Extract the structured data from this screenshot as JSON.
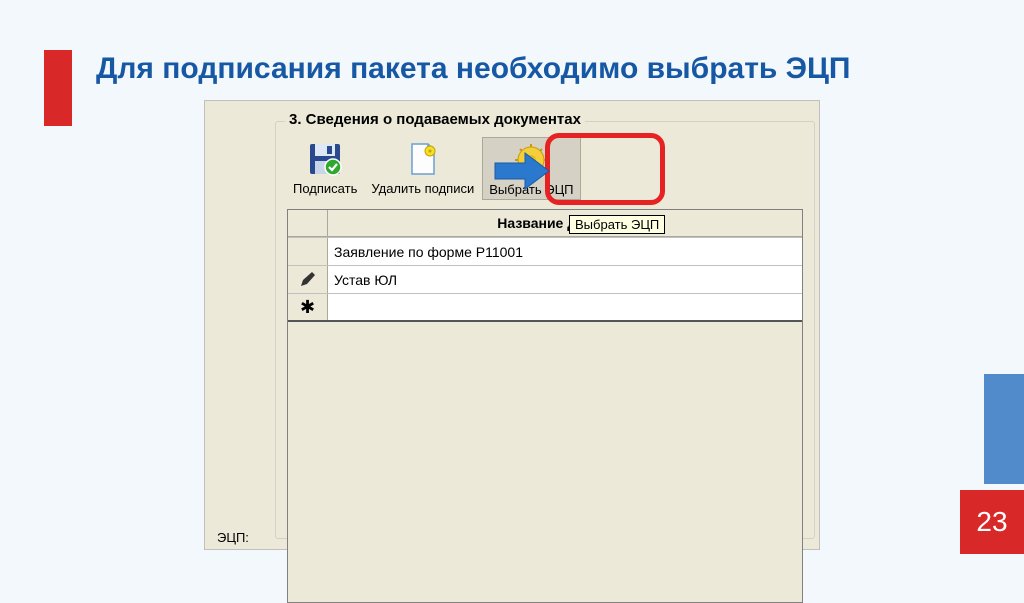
{
  "slide": {
    "title": "Для подписания пакета необходимо выбрать ЭЦП",
    "page_number": "23"
  },
  "panel": {
    "legend": "3. Сведения о подаваемых документах",
    "bottom_label": "ЭЦП:"
  },
  "toolbar": {
    "sign_label": "Подписать",
    "delete_sig_label": "Удалить подписи",
    "choose_cert_label": "Выбрать ЭЦП"
  },
  "tooltip": {
    "text": "Выбрать ЭЦП"
  },
  "grid": {
    "header": "Название документ",
    "rows": [
      {
        "marker": "",
        "name": "Заявление по форме Р11001"
      },
      {
        "marker": "pencil",
        "name": "Устав ЮЛ"
      },
      {
        "marker": "star",
        "name": ""
      }
    ]
  }
}
